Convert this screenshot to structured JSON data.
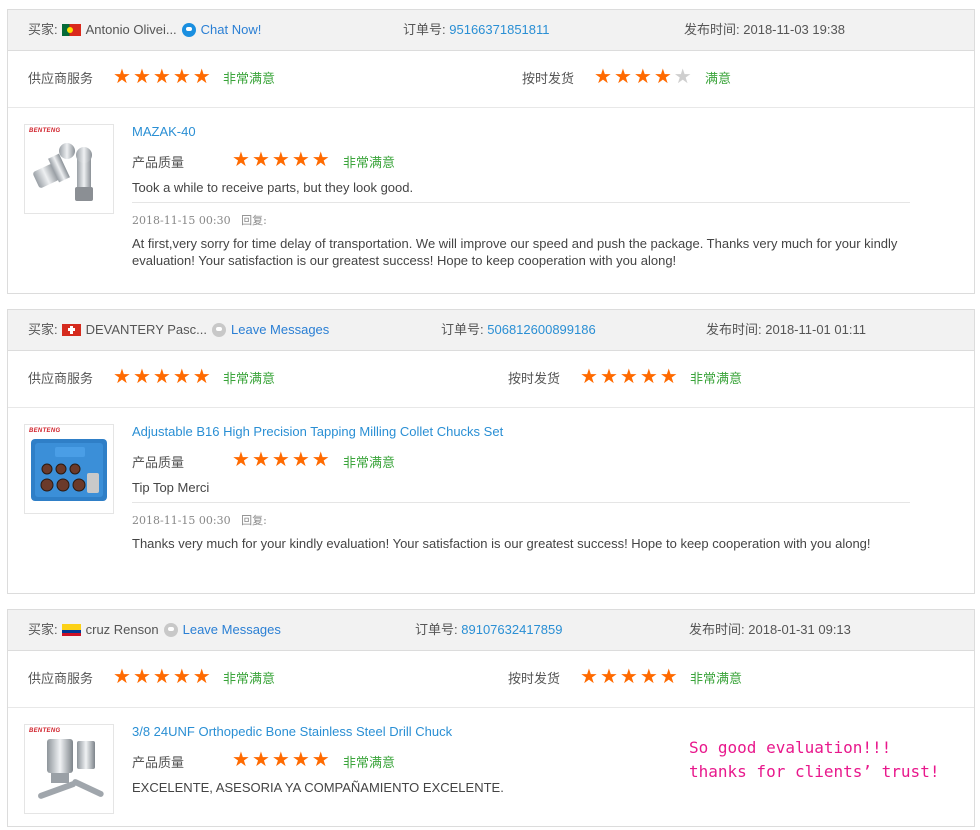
{
  "labels": {
    "buyer": "买家:",
    "order_no": "订单号:",
    "published": "发布时间:",
    "supplier_service": "供应商服务",
    "on_time_delivery": "按时发货",
    "product_quality": "产品质量",
    "reply": "回复:",
    "very_satisfied": "非常满意",
    "satisfied": "满意"
  },
  "reviews": [
    {
      "buyer_name": "Antonio Olivei...",
      "country_flag": "portugal-flag-icon",
      "chat_label": "Chat Now!",
      "order_number": "95166371851811",
      "publish_time": "2018-11-03 19:38",
      "supplier_service_rating": 5,
      "supplier_service_text": "非常满意",
      "delivery_rating": 4,
      "delivery_text": "满意",
      "product_title": "MAZAK-40",
      "product_quality_rating": 5,
      "product_quality_text": "非常满意",
      "comment": "Took a while to receive parts, but they look good.",
      "reply_time": "2018-11-15 00:30",
      "reply_text": "At first,very sorry for time delay of transportation. We will improve our speed and push the package. Thanks very much for your kindly evaluation! Your satisfaction is our greatest success! Hope to keep cooperation with you along!"
    },
    {
      "buyer_name": "DEVANTERY Pasc...",
      "country_flag": "switzerland-flag-icon",
      "chat_label": "Leave Messages",
      "order_number": "506812600899186",
      "publish_time": "2018-11-01 01:11",
      "supplier_service_rating": 5,
      "supplier_service_text": "非常满意",
      "delivery_rating": 5,
      "delivery_text": "非常满意",
      "product_title": "Adjustable B16 High Precision Tapping Milling Collet Chucks Set",
      "product_quality_rating": 5,
      "product_quality_text": "非常满意",
      "comment": "Tip Top Merci",
      "reply_time": "2018-11-15 00:30",
      "reply_text": "Thanks very much for your kindly evaluation! Your satisfaction is our greatest success! Hope to keep cooperation with you along!"
    },
    {
      "buyer_name": "cruz Renson",
      "country_flag": "colombia-flag-icon",
      "chat_label": "Leave Messages",
      "order_number": "89107632417859",
      "publish_time": "2018-01-31 09:13",
      "supplier_service_rating": 5,
      "supplier_service_text": "非常满意",
      "delivery_rating": 5,
      "delivery_text": "非常满意",
      "product_title": "3/8 24UNF Orthopedic Bone Stainless Steel Drill Chuck",
      "product_quality_rating": 5,
      "product_quality_text": "非常满意",
      "comment": "EXCELENTE, ASESORIA YA COMPAÑAMIENTO EXCELENTE."
    }
  ],
  "brand_logo": "BENTENG",
  "annotation": {
    "line1": "So good evaluation!!!",
    "line2": "thanks for clients’ trust!"
  },
  "colors": {
    "star": "#ff6a00",
    "star_empty": "#cfcfcf",
    "satisfied_text": "#3aa43a",
    "link": "#2a8fd4",
    "annotation": "#e8188c"
  }
}
